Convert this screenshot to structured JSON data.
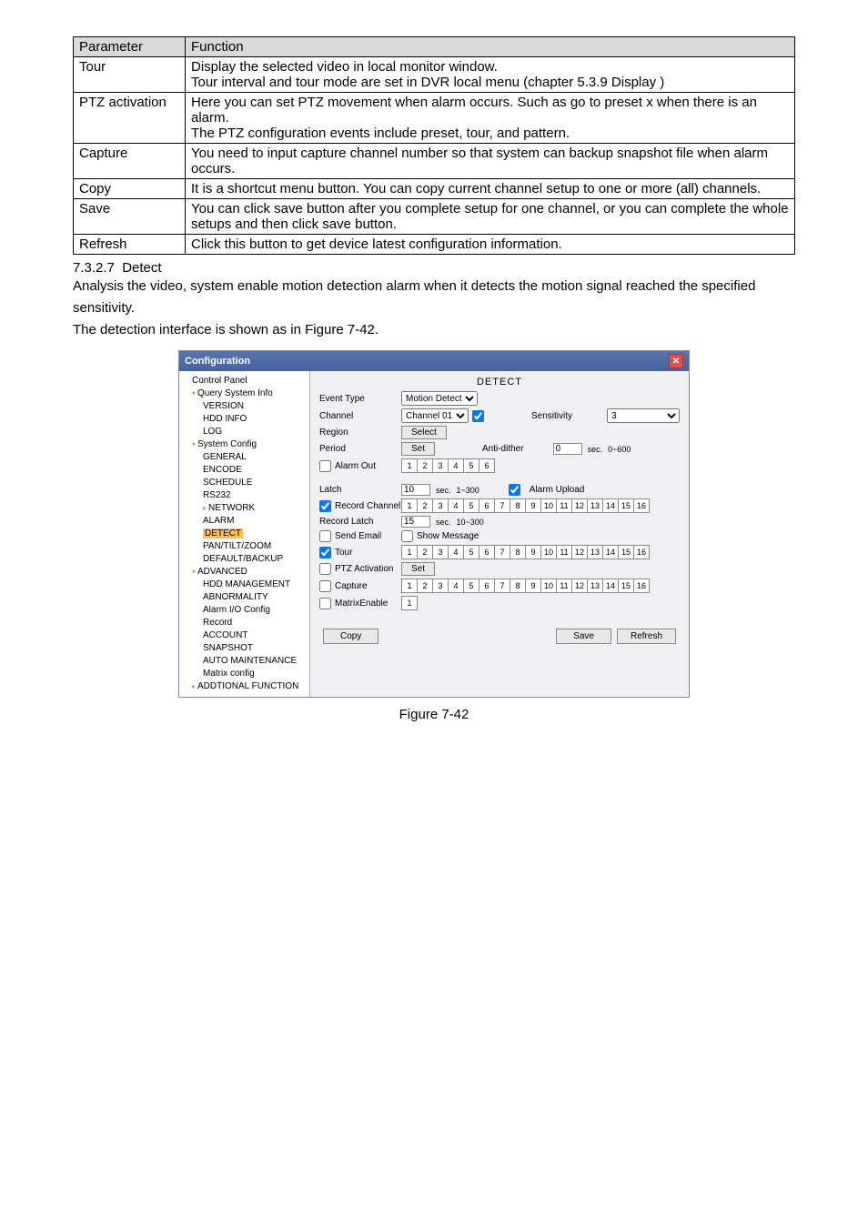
{
  "table": {
    "headers": [
      "Parameter",
      "Function"
    ],
    "rows": [
      {
        "p": "Tour",
        "f": "Display the selected video in local monitor window.\nTour interval and tour mode are set in DVR local menu (chapter 5.3.9 Display )"
      },
      {
        "p": "PTZ activation",
        "f": "Here you can set PTZ movement when alarm occurs. Such as go to preset x when there is an alarm.\nThe PTZ configuration events include preset, tour, and pattern."
      },
      {
        "p": "Capture",
        "f": "You need to input capture channel number so that system can backup snapshot file when alarm occurs."
      },
      {
        "p": "Copy",
        "f": "It is a shortcut menu button. You can copy current channel setup to one or more (all) channels."
      },
      {
        "p": "Save",
        "f": "You can click save button after you complete setup for one channel, or you can complete the whole setups and then click save button."
      },
      {
        "p": "Refresh",
        "f": "Click this button to get device latest configuration information."
      }
    ]
  },
  "section": {
    "num": "7.3.2.7",
    "title": "Detect",
    "para1": "Analysis the video, system enable motion detection alarm when it detects the motion signal reached the specified sensitivity.",
    "para2": "The detection interface is shown as in Figure 7-42."
  },
  "window": {
    "title": "Configuration",
    "tree": {
      "root": "Control Panel",
      "query": "Query System Info",
      "query_children": [
        "VERSION",
        "HDD INFO",
        "LOG"
      ],
      "syscfg": "System Config",
      "syscfg_children_top": [
        "GENERAL",
        "ENCODE",
        "SCHEDULE",
        "RS232"
      ],
      "network": "NETWORK",
      "alarm": "ALARM",
      "detect": "DETECT",
      "syscfg_children_bottom": [
        "PAN/TILT/ZOOM",
        "DEFAULT/BACKUP"
      ],
      "advanced": "ADVANCED",
      "advanced_children": [
        "HDD MANAGEMENT",
        "ABNORMALITY",
        "Alarm I/O Config",
        "Record",
        "ACCOUNT",
        "SNAPSHOT",
        "AUTO MAINTENANCE",
        "Matrix config"
      ],
      "addtional": "ADDTIONAL FUNCTION"
    },
    "form": {
      "heading": "DETECT",
      "event_type_label": "Event Type",
      "event_type_value": "Motion Detect",
      "channel_label": "Channel",
      "channel_value": "Channel 01",
      "sensitivity_label": "Sensitivity",
      "sensitivity_value": "3",
      "region_label": "Region",
      "region_btn": "Select",
      "period_label": "Period",
      "period_btn": "Set",
      "antidither_label": "Anti-dither",
      "antidither_value": "0",
      "antidither_unit": "sec.",
      "antidither_range": "0~600",
      "alarmout_label": "Alarm Out",
      "alarmout_channels": [
        "1",
        "2",
        "3",
        "4",
        "5",
        "6"
      ],
      "latch_label": "Latch",
      "latch_value": "10",
      "latch_unit": "sec.",
      "latch_range": "1~300",
      "alarm_upload_label": "Alarm Upload",
      "record_channel_label": "Record Channel",
      "channels16": [
        "1",
        "2",
        "3",
        "4",
        "5",
        "6",
        "7",
        "8",
        "9",
        "10",
        "11",
        "12",
        "13",
        "14",
        "15",
        "16"
      ],
      "record_latch_label": "Record Latch",
      "record_latch_value": "15",
      "record_latch_unit": "sec.",
      "record_latch_range": "10~300",
      "send_email_label": "Send Email",
      "show_message_label": "Show Message",
      "tour_label": "Tour",
      "ptz_activation_label": "PTZ Activation",
      "ptz_activation_btn": "Set",
      "capture_label": "Capture",
      "matrix_enable_label": "MatrixEnable",
      "matrix_ch": "1",
      "copy_btn": "Copy",
      "save_btn": "Save",
      "refresh_btn": "Refresh"
    }
  },
  "figure_caption": "Figure 7-42"
}
